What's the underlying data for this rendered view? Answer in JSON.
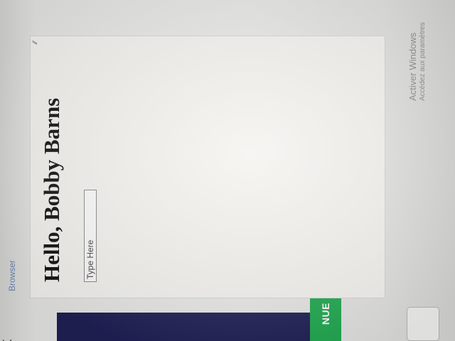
{
  "header": {
    "fragment_text": "t",
    "browser_label": "Browser"
  },
  "side_button": {
    "label": "NUE"
  },
  "browser": {
    "greeting": "Hello, Bobby Barns",
    "input_placeholder": "Type Here"
  },
  "watermark": {
    "title": "Activer Windows",
    "subtitle": "Accédez aux paramètres"
  }
}
